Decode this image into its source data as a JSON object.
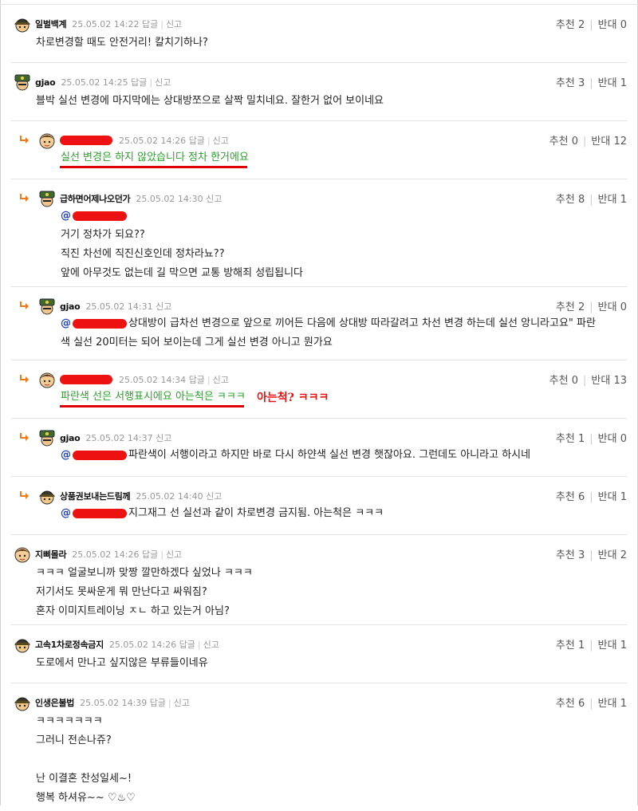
{
  "ui": {
    "reply_label": "답글",
    "report_label": "신고",
    "up_label": "추천",
    "down_label": "반대"
  },
  "annotation": "아는척? ㅋㅋㅋ",
  "icons": {
    "reply_arrow": "reply-arrow-icon",
    "accent_orange": "#f07a1a",
    "redaction_red": "#ee1111",
    "green_text": "#28a428"
  },
  "comments": [
    {
      "nick": "일벌백계",
      "date": "25.05.02 14:22",
      "up": "2",
      "down": "0",
      "lines": [
        "차로변경할 때도 안전거리! 칼치기하나?"
      ]
    },
    {
      "nick": "gjao",
      "date": "25.05.02 14:25",
      "up": "3",
      "down": "1",
      "lines": [
        "블박 실선 변경에 마지막에는 상대방쪼으로 살짝 밀치네요. 잘한거 없어 보이네요"
      ]
    },
    {
      "nick": "",
      "date": "25.05.02 14:26",
      "up": "0",
      "down": "12",
      "lines": [
        "실선 변경은 하지 않았습니다 정차 한거에요"
      ]
    },
    {
      "nick": "급하면어제나오던가",
      "date": "25.05.02 14:30",
      "up": "8",
      "down": "1",
      "lines": [
        "@",
        "거기 정차가 되요??",
        "직진 차선에 직진신호인데 정차라뇨??",
        "앞에 아무것도 없는데 길 막으면 교통 방해죄 성립됩니다"
      ]
    },
    {
      "nick": "gjao",
      "date": "25.05.02 14:31",
      "up": "2",
      "down": "0",
      "lines": [
        "@",
        "상대방이 급차선 변경으로 앞으로 끼어든 다음에 상대방 따라갈려고 차선 변경 하는데 실선 앙니라고요\" 파란",
        "색 실선 20미터는 되어 보이는데 그게 실선 변경 아니고 뭔가요"
      ]
    },
    {
      "nick": "",
      "date": "25.05.02 14:34",
      "up": "0",
      "down": "13",
      "lines": [
        "파란색 선은 서행표시에요 아는척은 ㅋㅋㅋ"
      ]
    },
    {
      "nick": "gjao",
      "date": "25.05.02 14:37",
      "up": "1",
      "down": "0",
      "lines": [
        "@",
        "파란색이 서행이라고 하지만 바로 다시 하얀색 실선 변경 햇잖아요. 그런데도 아니라고 하시네"
      ]
    },
    {
      "nick": "상품권보내는드림께",
      "date": "25.05.02 14:40",
      "up": "6",
      "down": "1",
      "lines": [
        "@",
        "지그재그 선 실선과 같이 차로변경 금지됨. 아는척은 ㅋㅋㅋ"
      ]
    },
    {
      "nick": "지삐몰라",
      "date": "25.05.02 14:26",
      "up": "3",
      "down": "2",
      "lines": [
        "ㅋㅋㅋ 얼굴보니까 맞짱 깔만하겠다 싶었나 ㅋㅋㅋ",
        "저기서도 못싸운게 뭐 만난다고 싸워짐?",
        "혼자 이미지트레이닝 ㅈㄴ 하고 있는거 아님?"
      ]
    },
    {
      "nick": "고속1차로정속금지",
      "date": "25.05.02 14:26",
      "up": "1",
      "down": "1",
      "lines": [
        "도로에서 만나고 싶지않은 부류들이네유"
      ]
    },
    {
      "nick": "인생은불법",
      "date": "25.05.02 14:39",
      "up": "6",
      "down": "1",
      "lines": [
        "ㅋㅋㅋㅋㅋㅋㅋ",
        "그러니 전손나쥬?",
        "",
        "난 이결혼 찬성일세~!",
        "행복 하셔유~~ ♡♨♡"
      ]
    }
  ]
}
